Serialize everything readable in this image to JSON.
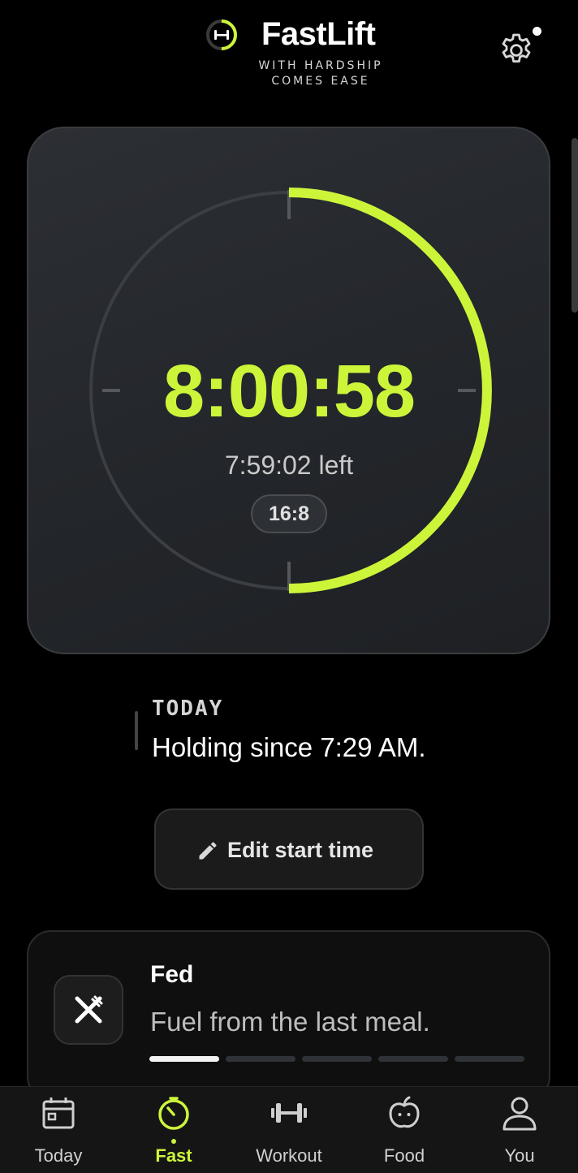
{
  "header": {
    "app_name": "FastLift",
    "tagline_line1": "WITH HARDSHIP",
    "tagline_line2": "COMES EASE",
    "logo_icon": "barbell-ring-icon",
    "settings_icon": "gear-icon"
  },
  "timer": {
    "elapsed": "8:00:58",
    "remaining": "7:59:02 left",
    "protocol": "16:8",
    "progress": 0.5
  },
  "status": {
    "label": "TODAY",
    "text": "Holding since 7:29 AM."
  },
  "actions": {
    "edit_start_label": "Edit start time",
    "edit_icon": "pencil-icon"
  },
  "stage": {
    "title": "Fed",
    "subtitle": "Fuel from the last meal.",
    "icon": "fork-knife-icon",
    "current_stage": 1,
    "total_stages": 5
  },
  "nav": {
    "items": [
      {
        "label": "Today",
        "icon": "calendar-icon",
        "active": false
      },
      {
        "label": "Fast",
        "icon": "timer-icon",
        "active": true
      },
      {
        "label": "Workout",
        "icon": "dumbbell-icon",
        "active": false
      },
      {
        "label": "Food",
        "icon": "apple-icon",
        "active": false
      },
      {
        "label": "You",
        "icon": "person-icon",
        "active": false
      }
    ]
  },
  "colors": {
    "accent": "#ccf53a",
    "background": "#000000",
    "card": "#25282c"
  }
}
